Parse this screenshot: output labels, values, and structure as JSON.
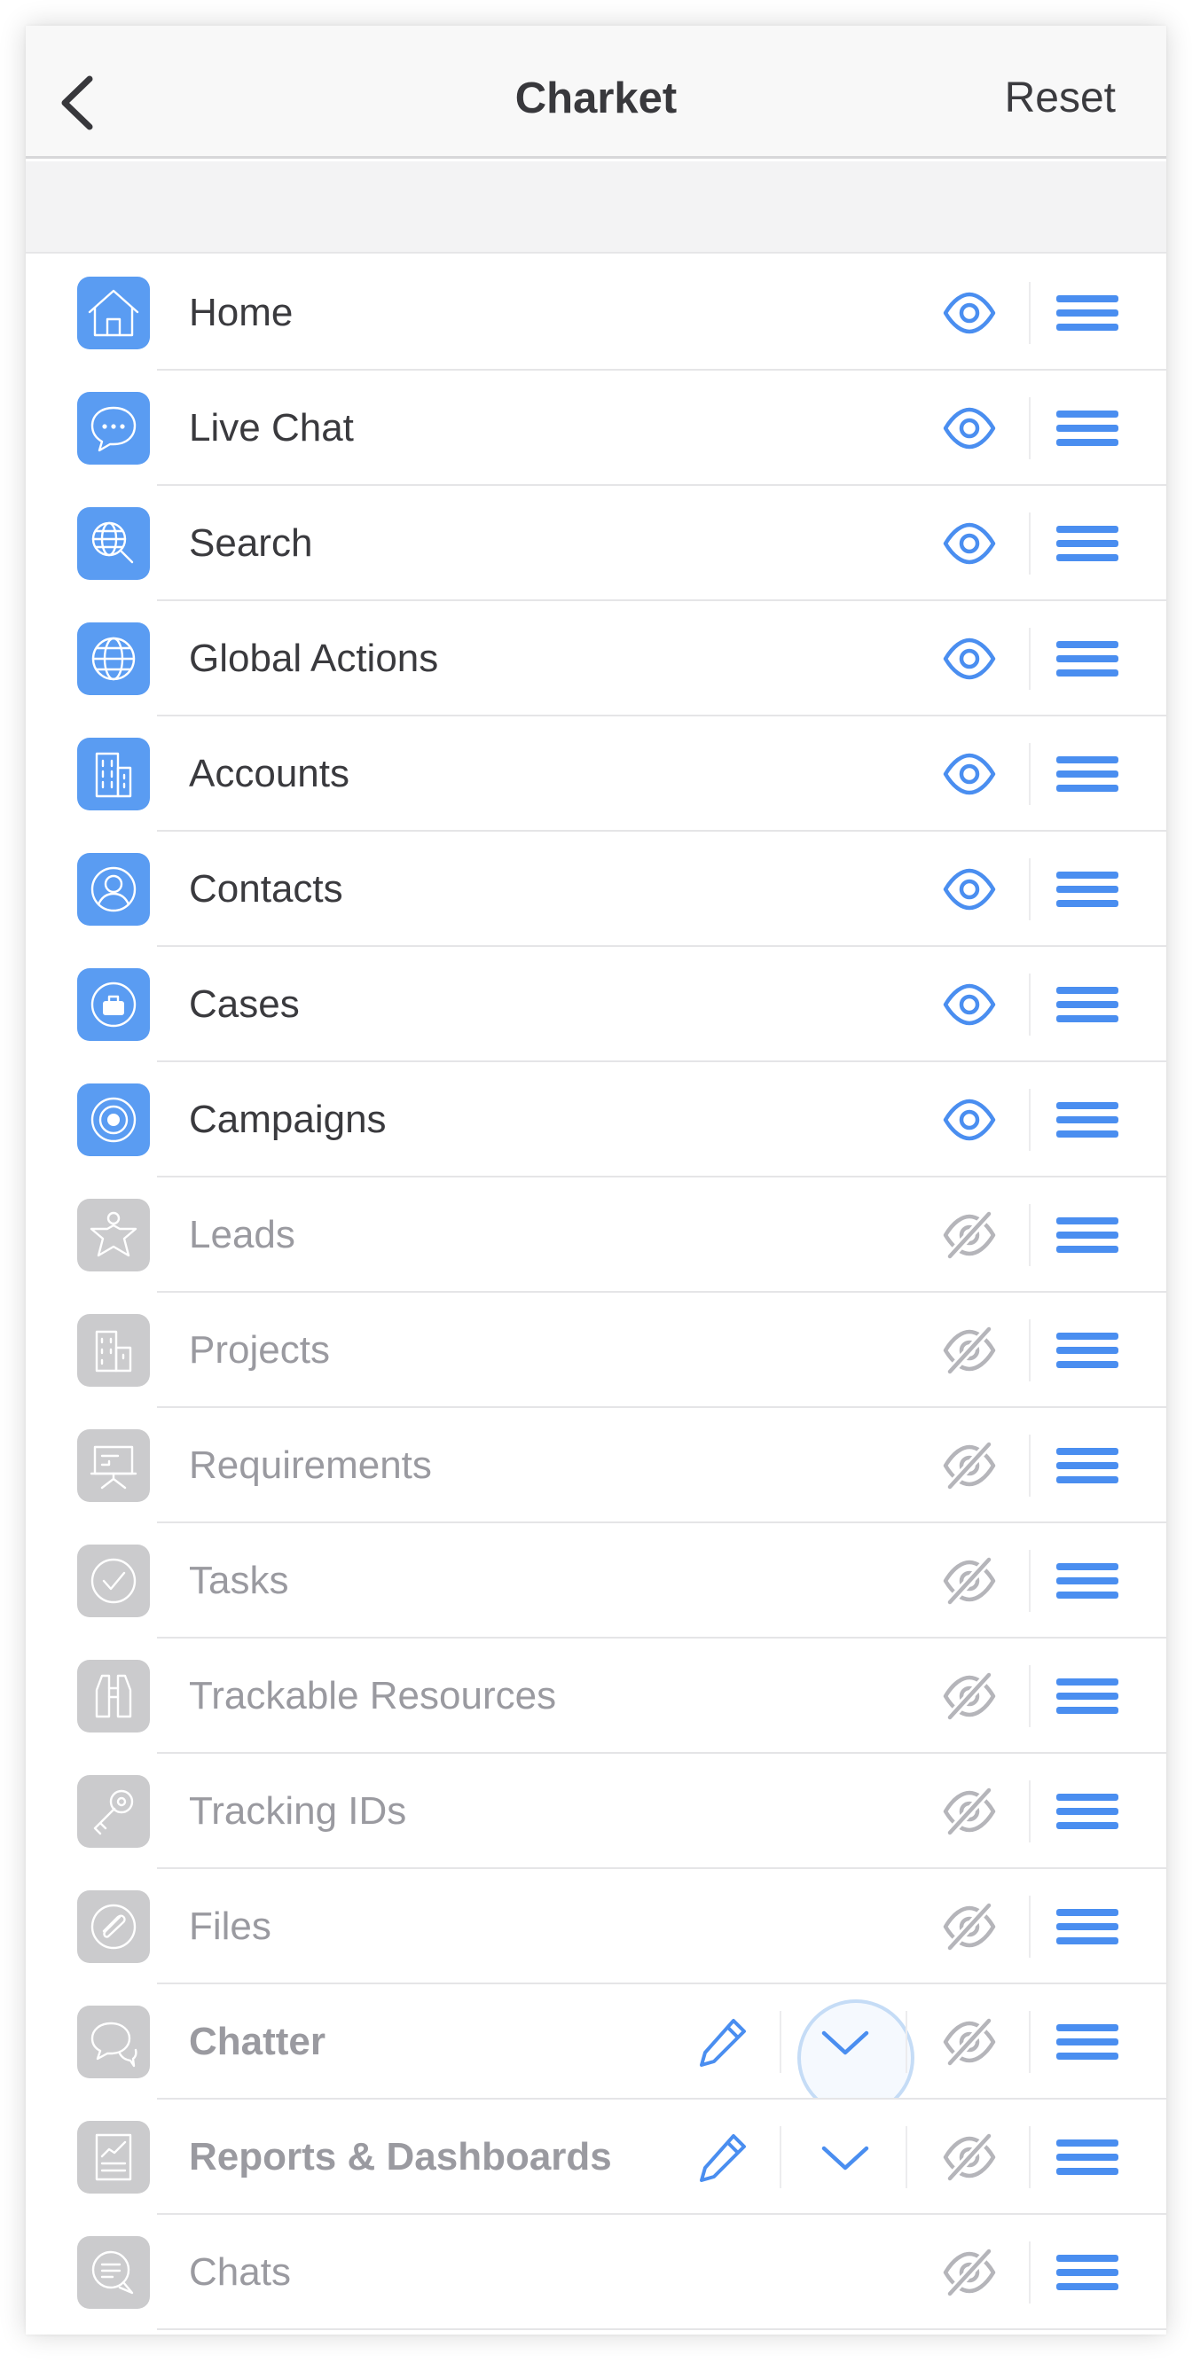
{
  "header": {
    "title": "Charket",
    "reset_label": "Reset"
  },
  "colors": {
    "accent": "#4a8ef0",
    "icon_active_bg": "#5a9cf2",
    "icon_inactive_bg": "#cbcbcd",
    "hidden_eye": "#b5b5ba"
  },
  "items": [
    {
      "label": "Home",
      "icon": "home-icon",
      "visible": true
    },
    {
      "label": "Live Chat",
      "icon": "chat-bubble-icon",
      "visible": true
    },
    {
      "label": "Search",
      "icon": "globe-search-icon",
      "visible": true
    },
    {
      "label": "Global Actions",
      "icon": "globe-icon",
      "visible": true
    },
    {
      "label": "Accounts",
      "icon": "building-icon",
      "visible": true
    },
    {
      "label": "Contacts",
      "icon": "contact-icon",
      "visible": true
    },
    {
      "label": "Cases",
      "icon": "briefcase-icon",
      "visible": true
    },
    {
      "label": "Campaigns",
      "icon": "target-icon",
      "visible": true
    },
    {
      "label": "Leads",
      "icon": "star-person-icon",
      "visible": false
    },
    {
      "label": "Projects",
      "icon": "office-building-icon",
      "visible": false
    },
    {
      "label": "Requirements",
      "icon": "presentation-board-icon",
      "visible": false
    },
    {
      "label": "Tasks",
      "icon": "check-circle-icon",
      "visible": false
    },
    {
      "label": "Trackable Resources",
      "icon": "binoculars-icon",
      "visible": false
    },
    {
      "label": "Tracking IDs",
      "icon": "key-icon",
      "visible": false
    },
    {
      "label": "Files",
      "icon": "paperclip-icon",
      "visible": false
    },
    {
      "label": "Chatter",
      "icon": "chatter-icon",
      "visible": false,
      "expandable": true
    },
    {
      "label": "Reports & Dashboards",
      "icon": "report-icon",
      "visible": false,
      "expandable": true
    },
    {
      "label": "Chats",
      "icon": "chats-icon",
      "visible": false
    }
  ]
}
